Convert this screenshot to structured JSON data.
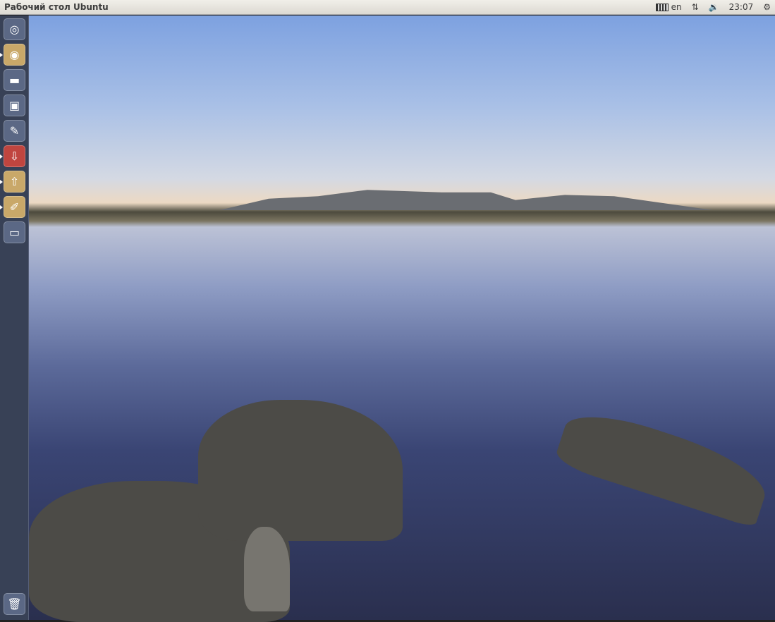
{
  "panel": {
    "title": "Рабочий стол Ubuntu",
    "keyboard_layout": "en",
    "clock": "23:07"
  },
  "launcher": {
    "items": [
      {
        "name": "dash",
        "glyph": "◎",
        "color": "#5b6885",
        "running": false
      },
      {
        "name": "chrome",
        "glyph": "◉",
        "color": "#c9a869",
        "running": true
      },
      {
        "name": "files",
        "glyph": "▬",
        "color": "#5b6885",
        "running": false
      },
      {
        "name": "software-center",
        "glyph": "▣",
        "color": "#5b6885",
        "running": false
      },
      {
        "name": "system-settings",
        "glyph": "✎",
        "color": "#5b6885",
        "running": false
      },
      {
        "name": "update-manager",
        "glyph": "⇩",
        "color": "#c0453f",
        "running": true
      },
      {
        "name": "archive-manager",
        "glyph": "⇧",
        "color": "#c9a869",
        "running": true
      },
      {
        "name": "paint",
        "glyph": "✐",
        "color": "#c9a869",
        "running": true
      },
      {
        "name": "workspaces",
        "glyph": "▭",
        "color": "#5b6885",
        "running": false
      }
    ],
    "trash_glyph": "🗑"
  }
}
